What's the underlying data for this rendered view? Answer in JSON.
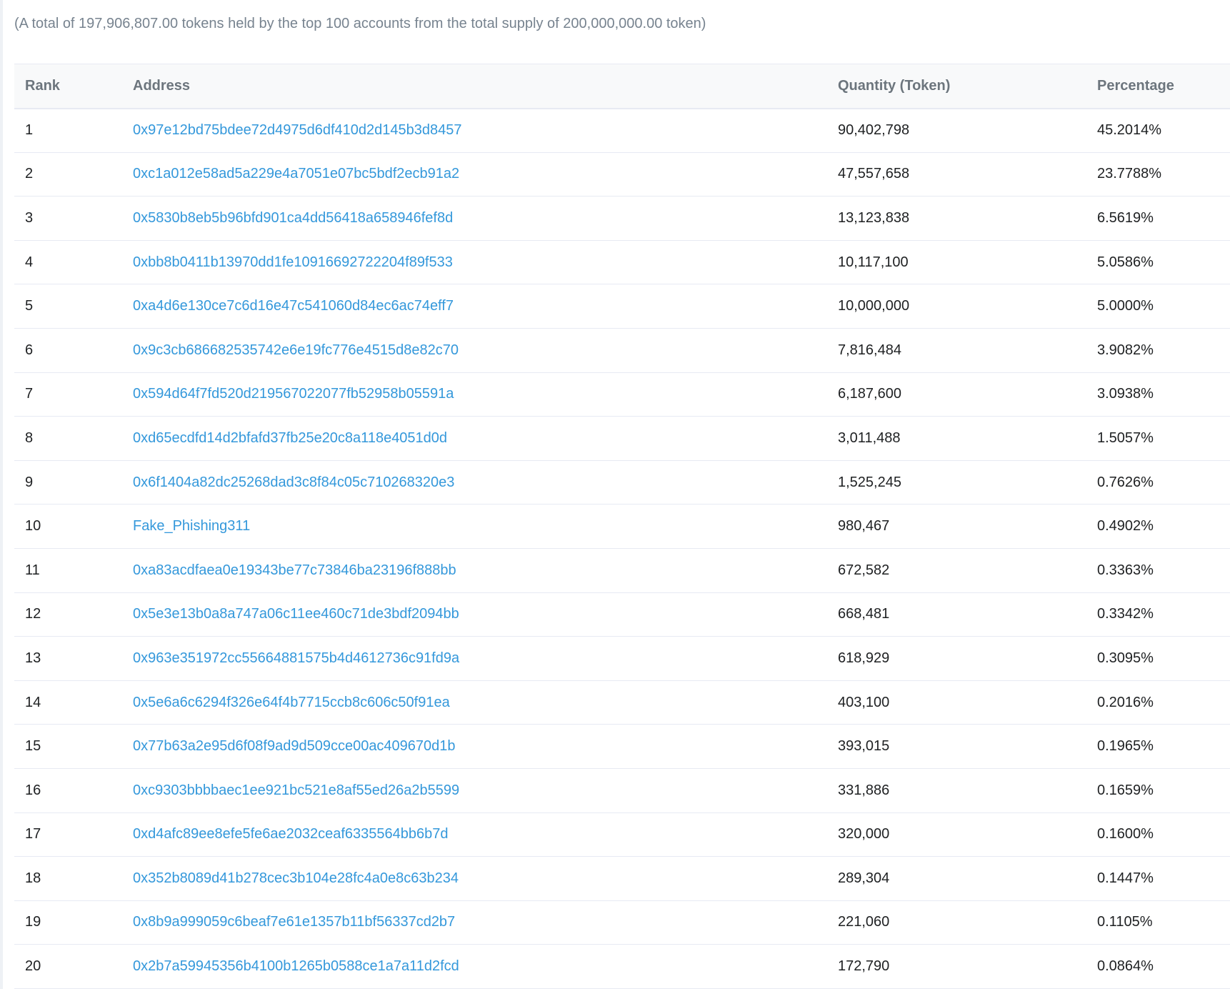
{
  "summary": "(A total of 197,906,807.00 tokens held by the top 100 accounts from the total supply of 200,000,000.00 token)",
  "table": {
    "headers": {
      "rank": "Rank",
      "address": "Address",
      "quantity": "Quantity (Token)",
      "percentage": "Percentage"
    },
    "rows": [
      {
        "rank": "1",
        "address": "0x97e12bd75bdee72d4975d6df410d2d145b3d8457",
        "quantity": "90,402,798",
        "percentage": "45.2014%"
      },
      {
        "rank": "2",
        "address": "0xc1a012e58ad5a229e4a7051e07bc5bdf2ecb91a2",
        "quantity": "47,557,658",
        "percentage": "23.7788%"
      },
      {
        "rank": "3",
        "address": "0x5830b8eb5b96bfd901ca4dd56418a658946fef8d",
        "quantity": "13,123,838",
        "percentage": "6.5619%"
      },
      {
        "rank": "4",
        "address": "0xbb8b0411b13970dd1fe10916692722204f89f533",
        "quantity": "10,117,100",
        "percentage": "5.0586%"
      },
      {
        "rank": "5",
        "address": "0xa4d6e130ce7c6d16e47c541060d84ec6ac74eff7",
        "quantity": "10,000,000",
        "percentage": "5.0000%"
      },
      {
        "rank": "6",
        "address": "0x9c3cb686682535742e6e19fc776e4515d8e82c70",
        "quantity": "7,816,484",
        "percentage": "3.9082%"
      },
      {
        "rank": "7",
        "address": "0x594d64f7fd520d219567022077fb52958b05591a",
        "quantity": "6,187,600",
        "percentage": "3.0938%"
      },
      {
        "rank": "8",
        "address": "0xd65ecdfd14d2bfafd37fb25e20c8a118e4051d0d",
        "quantity": "3,011,488",
        "percentage": "1.5057%"
      },
      {
        "rank": "9",
        "address": "0x6f1404a82dc25268dad3c8f84c05c710268320e3",
        "quantity": "1,525,245",
        "percentage": "0.7626%"
      },
      {
        "rank": "10",
        "address": "Fake_Phishing311",
        "quantity": "980,467",
        "percentage": "0.4902%"
      },
      {
        "rank": "11",
        "address": "0xa83acdfaea0e19343be77c73846ba23196f888bb",
        "quantity": "672,582",
        "percentage": "0.3363%"
      },
      {
        "rank": "12",
        "address": "0x5e3e13b0a8a747a06c11ee460c71de3bdf2094bb",
        "quantity": "668,481",
        "percentage": "0.3342%"
      },
      {
        "rank": "13",
        "address": "0x963e351972cc55664881575b4d4612736c91fd9a",
        "quantity": "618,929",
        "percentage": "0.3095%"
      },
      {
        "rank": "14",
        "address": "0x5e6a6c6294f326e64f4b7715ccb8c606c50f91ea",
        "quantity": "403,100",
        "percentage": "0.2016%"
      },
      {
        "rank": "15",
        "address": "0x77b63a2e95d6f08f9ad9d509cce00ac409670d1b",
        "quantity": "393,015",
        "percentage": "0.1965%"
      },
      {
        "rank": "16",
        "address": "0xc9303bbbbaec1ee921bc521e8af55ed26a2b5599",
        "quantity": "331,886",
        "percentage": "0.1659%"
      },
      {
        "rank": "17",
        "address": "0xd4afc89ee8efe5fe6ae2032ceaf6335564bb6b7d",
        "quantity": "320,000",
        "percentage": "0.1600%"
      },
      {
        "rank": "18",
        "address": "0x352b8089d41b278cec3b104e28fc4a0e8c63b234",
        "quantity": "289,304",
        "percentage": "0.1447%"
      },
      {
        "rank": "19",
        "address": "0x8b9a999059c6beaf7e61e1357b11bf56337cd2b7",
        "quantity": "221,060",
        "percentage": "0.1105%"
      },
      {
        "rank": "20",
        "address": "0x2b7a59945356b4100b1265b0588ce1a7a11d2fcd",
        "quantity": "172,790",
        "percentage": "0.0864%"
      }
    ]
  },
  "colors": {
    "link": "#3498db",
    "header_text": "#6c757d",
    "summary_text": "#77838f",
    "body_text": "#1e2022",
    "border": "#e7eaf3",
    "header_bg": "#f8f9fa"
  }
}
